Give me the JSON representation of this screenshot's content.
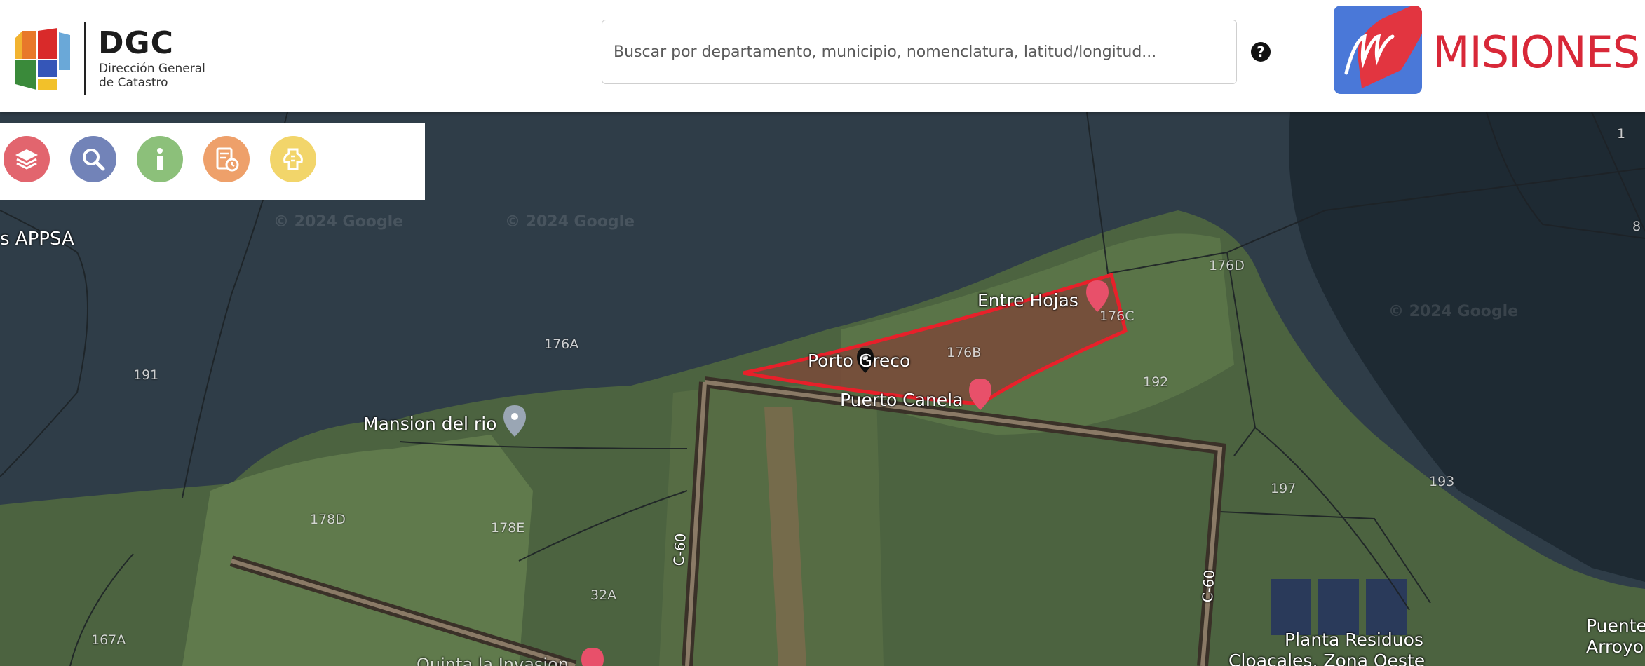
{
  "header": {
    "logo_title": "DGC",
    "logo_subtitle_line1": "Dirección General",
    "logo_subtitle_line2": "de Catastro",
    "search_placeholder": "Buscar por departamento, municipio, nomenclatura, latitud/longitud...",
    "help_label": "?",
    "brand_text": "MISIONES"
  },
  "toolbar": {
    "buttons": [
      {
        "icon": "layers-icon",
        "color": "#e2656e"
      },
      {
        "icon": "search-icon",
        "color": "#7283b8"
      },
      {
        "icon": "info-icon",
        "color": "#8cc07a"
      },
      {
        "icon": "report-icon",
        "color": "#eea06a"
      },
      {
        "icon": "tool-icon",
        "color": "#f2d56a"
      }
    ]
  },
  "map": {
    "place_labels": {
      "appsa": "s APPSA",
      "mansion": "Mansion del rio",
      "entre_hojas": "Entre Hojas",
      "porto_greco": "Porto Greco",
      "puerto_candelaria": "Puerto Canela",
      "planta_line1": "Planta Residuos",
      "planta_line2": "Cloacales, Zona Oeste",
      "puente_line1": "Puente",
      "puente_line2": "Arroyo",
      "quinta": "Quinta la Invasion"
    },
    "road_labels": {
      "c60_left": "C-60",
      "c60_right": "C-60"
    },
    "lot_labels": {
      "l176a": "176A",
      "l191": "191",
      "l176d": "176D",
      "l176c": "176C",
      "l176b": "176B",
      "l192": "192",
      "l178d": "178D",
      "l178e": "178E",
      "l197": "197",
      "l193": "193",
      "l32a": "32A",
      "l167a": "167A",
      "l1": "1",
      "l8": "8"
    },
    "watermarks": [
      "© 2024 Google",
      "© 2024 Google",
      "© 2024 Google"
    ],
    "selection_color": "#e8202a"
  }
}
